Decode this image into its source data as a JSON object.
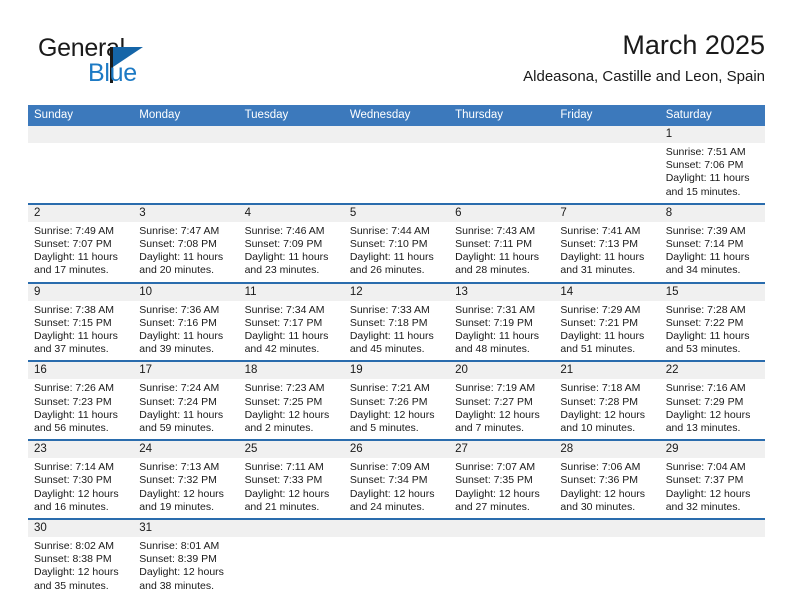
{
  "brand": {
    "name_part1": "General",
    "name_part2": "Blue"
  },
  "header": {
    "title": "March 2025",
    "subtitle": "Aldeasona, Castille and Leon, Spain"
  },
  "colors": {
    "header_blue": "#3c79bc",
    "separator_blue": "#2a6cad",
    "day_band_gray": "#f0f0f0",
    "brand_blue": "#1d7ac4",
    "text": "#1a1a1a"
  },
  "weekdays": [
    "Sunday",
    "Monday",
    "Tuesday",
    "Wednesday",
    "Thursday",
    "Friday",
    "Saturday"
  ],
  "weeks": [
    [
      {
        "day": "",
        "sunrise": "",
        "sunset": "",
        "daylight": "",
        "empty": true
      },
      {
        "day": "",
        "sunrise": "",
        "sunset": "",
        "daylight": "",
        "empty": true
      },
      {
        "day": "",
        "sunrise": "",
        "sunset": "",
        "daylight": "",
        "empty": true
      },
      {
        "day": "",
        "sunrise": "",
        "sunset": "",
        "daylight": "",
        "empty": true
      },
      {
        "day": "",
        "sunrise": "",
        "sunset": "",
        "daylight": "",
        "empty": true
      },
      {
        "day": "",
        "sunrise": "",
        "sunset": "",
        "daylight": "",
        "empty": true
      },
      {
        "day": "1",
        "sunrise": "Sunrise: 7:51 AM",
        "sunset": "Sunset: 7:06 PM",
        "daylight": "Daylight: 11 hours and 15 minutes."
      }
    ],
    [
      {
        "day": "2",
        "sunrise": "Sunrise: 7:49 AM",
        "sunset": "Sunset: 7:07 PM",
        "daylight": "Daylight: 11 hours and 17 minutes."
      },
      {
        "day": "3",
        "sunrise": "Sunrise: 7:47 AM",
        "sunset": "Sunset: 7:08 PM",
        "daylight": "Daylight: 11 hours and 20 minutes."
      },
      {
        "day": "4",
        "sunrise": "Sunrise: 7:46 AM",
        "sunset": "Sunset: 7:09 PM",
        "daylight": "Daylight: 11 hours and 23 minutes."
      },
      {
        "day": "5",
        "sunrise": "Sunrise: 7:44 AM",
        "sunset": "Sunset: 7:10 PM",
        "daylight": "Daylight: 11 hours and 26 minutes."
      },
      {
        "day": "6",
        "sunrise": "Sunrise: 7:43 AM",
        "sunset": "Sunset: 7:11 PM",
        "daylight": "Daylight: 11 hours and 28 minutes."
      },
      {
        "day": "7",
        "sunrise": "Sunrise: 7:41 AM",
        "sunset": "Sunset: 7:13 PM",
        "daylight": "Daylight: 11 hours and 31 minutes."
      },
      {
        "day": "8",
        "sunrise": "Sunrise: 7:39 AM",
        "sunset": "Sunset: 7:14 PM",
        "daylight": "Daylight: 11 hours and 34 minutes."
      }
    ],
    [
      {
        "day": "9",
        "sunrise": "Sunrise: 7:38 AM",
        "sunset": "Sunset: 7:15 PM",
        "daylight": "Daylight: 11 hours and 37 minutes."
      },
      {
        "day": "10",
        "sunrise": "Sunrise: 7:36 AM",
        "sunset": "Sunset: 7:16 PM",
        "daylight": "Daylight: 11 hours and 39 minutes."
      },
      {
        "day": "11",
        "sunrise": "Sunrise: 7:34 AM",
        "sunset": "Sunset: 7:17 PM",
        "daylight": "Daylight: 11 hours and 42 minutes."
      },
      {
        "day": "12",
        "sunrise": "Sunrise: 7:33 AM",
        "sunset": "Sunset: 7:18 PM",
        "daylight": "Daylight: 11 hours and 45 minutes."
      },
      {
        "day": "13",
        "sunrise": "Sunrise: 7:31 AM",
        "sunset": "Sunset: 7:19 PM",
        "daylight": "Daylight: 11 hours and 48 minutes."
      },
      {
        "day": "14",
        "sunrise": "Sunrise: 7:29 AM",
        "sunset": "Sunset: 7:21 PM",
        "daylight": "Daylight: 11 hours and 51 minutes."
      },
      {
        "day": "15",
        "sunrise": "Sunrise: 7:28 AM",
        "sunset": "Sunset: 7:22 PM",
        "daylight": "Daylight: 11 hours and 53 minutes."
      }
    ],
    [
      {
        "day": "16",
        "sunrise": "Sunrise: 7:26 AM",
        "sunset": "Sunset: 7:23 PM",
        "daylight": "Daylight: 11 hours and 56 minutes."
      },
      {
        "day": "17",
        "sunrise": "Sunrise: 7:24 AM",
        "sunset": "Sunset: 7:24 PM",
        "daylight": "Daylight: 11 hours and 59 minutes."
      },
      {
        "day": "18",
        "sunrise": "Sunrise: 7:23 AM",
        "sunset": "Sunset: 7:25 PM",
        "daylight": "Daylight: 12 hours and 2 minutes."
      },
      {
        "day": "19",
        "sunrise": "Sunrise: 7:21 AM",
        "sunset": "Sunset: 7:26 PM",
        "daylight": "Daylight: 12 hours and 5 minutes."
      },
      {
        "day": "20",
        "sunrise": "Sunrise: 7:19 AM",
        "sunset": "Sunset: 7:27 PM",
        "daylight": "Daylight: 12 hours and 7 minutes."
      },
      {
        "day": "21",
        "sunrise": "Sunrise: 7:18 AM",
        "sunset": "Sunset: 7:28 PM",
        "daylight": "Daylight: 12 hours and 10 minutes."
      },
      {
        "day": "22",
        "sunrise": "Sunrise: 7:16 AM",
        "sunset": "Sunset: 7:29 PM",
        "daylight": "Daylight: 12 hours and 13 minutes."
      }
    ],
    [
      {
        "day": "23",
        "sunrise": "Sunrise: 7:14 AM",
        "sunset": "Sunset: 7:30 PM",
        "daylight": "Daylight: 12 hours and 16 minutes."
      },
      {
        "day": "24",
        "sunrise": "Sunrise: 7:13 AM",
        "sunset": "Sunset: 7:32 PM",
        "daylight": "Daylight: 12 hours and 19 minutes."
      },
      {
        "day": "25",
        "sunrise": "Sunrise: 7:11 AM",
        "sunset": "Sunset: 7:33 PM",
        "daylight": "Daylight: 12 hours and 21 minutes."
      },
      {
        "day": "26",
        "sunrise": "Sunrise: 7:09 AM",
        "sunset": "Sunset: 7:34 PM",
        "daylight": "Daylight: 12 hours and 24 minutes."
      },
      {
        "day": "27",
        "sunrise": "Sunrise: 7:07 AM",
        "sunset": "Sunset: 7:35 PM",
        "daylight": "Daylight: 12 hours and 27 minutes."
      },
      {
        "day": "28",
        "sunrise": "Sunrise: 7:06 AM",
        "sunset": "Sunset: 7:36 PM",
        "daylight": "Daylight: 12 hours and 30 minutes."
      },
      {
        "day": "29",
        "sunrise": "Sunrise: 7:04 AM",
        "sunset": "Sunset: 7:37 PM",
        "daylight": "Daylight: 12 hours and 32 minutes."
      }
    ],
    [
      {
        "day": "30",
        "sunrise": "Sunrise: 8:02 AM",
        "sunset": "Sunset: 8:38 PM",
        "daylight": "Daylight: 12 hours and 35 minutes."
      },
      {
        "day": "31",
        "sunrise": "Sunrise: 8:01 AM",
        "sunset": "Sunset: 8:39 PM",
        "daylight": "Daylight: 12 hours and 38 minutes."
      },
      {
        "day": "",
        "sunrise": "",
        "sunset": "",
        "daylight": "",
        "empty": true
      },
      {
        "day": "",
        "sunrise": "",
        "sunset": "",
        "daylight": "",
        "empty": true
      },
      {
        "day": "",
        "sunrise": "",
        "sunset": "",
        "daylight": "",
        "empty": true
      },
      {
        "day": "",
        "sunrise": "",
        "sunset": "",
        "daylight": "",
        "empty": true
      },
      {
        "day": "",
        "sunrise": "",
        "sunset": "",
        "daylight": "",
        "empty": true
      }
    ]
  ]
}
